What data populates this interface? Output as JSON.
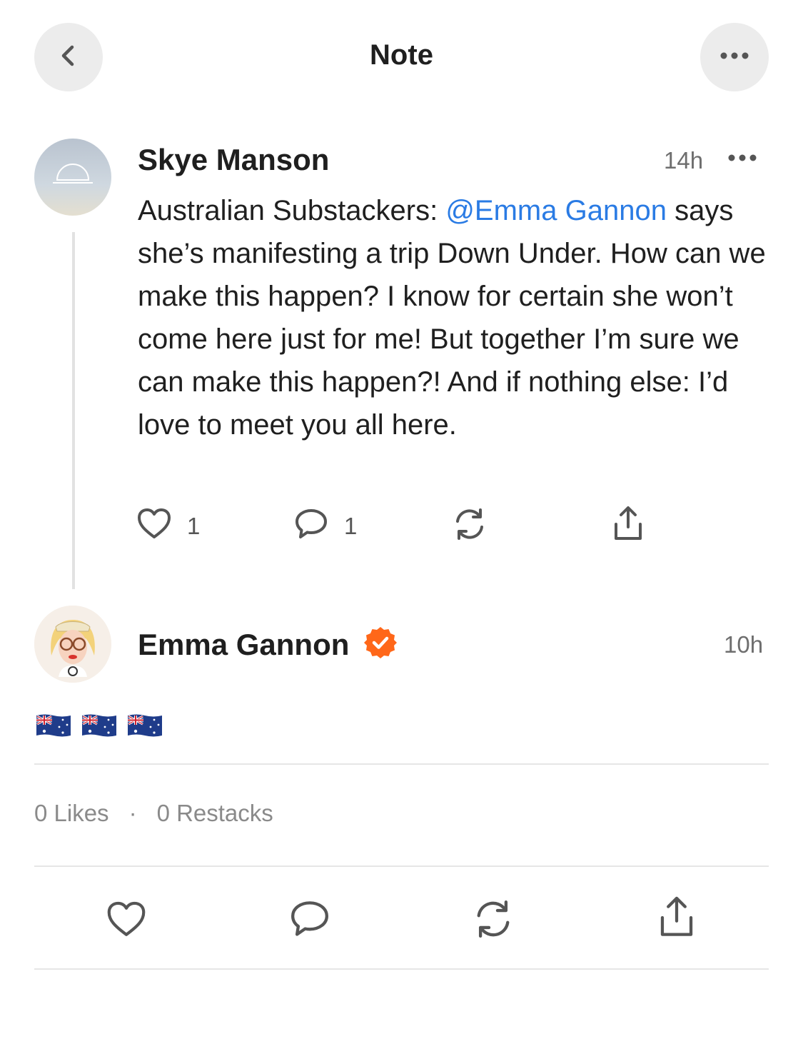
{
  "header": {
    "title": "Note"
  },
  "parent_note": {
    "author": "Skye Manson",
    "time": "14h",
    "body_prefix": "Australian Substackers: ",
    "mention": "@Emma Gannon",
    "body_suffix": " says she’s manifesting a trip Down Under. How can we make this happen? I know for certain she won’t come here just for me! But together I’m sure we can make this happen?! And if nothing else: I’d love to meet you all here.",
    "likes": "1",
    "comments": "1"
  },
  "reply": {
    "author": "Emma Gannon",
    "verified": true,
    "time": "10h",
    "flags": [
      "australia-flag",
      "australia-flag",
      "australia-flag"
    ]
  },
  "stats": {
    "likes": "0 Likes",
    "separator": "·",
    "restacks": "0 Restacks"
  },
  "colors": {
    "mention": "#2a7be4",
    "verified_badge": "#ff6719",
    "icon": "#555555"
  }
}
